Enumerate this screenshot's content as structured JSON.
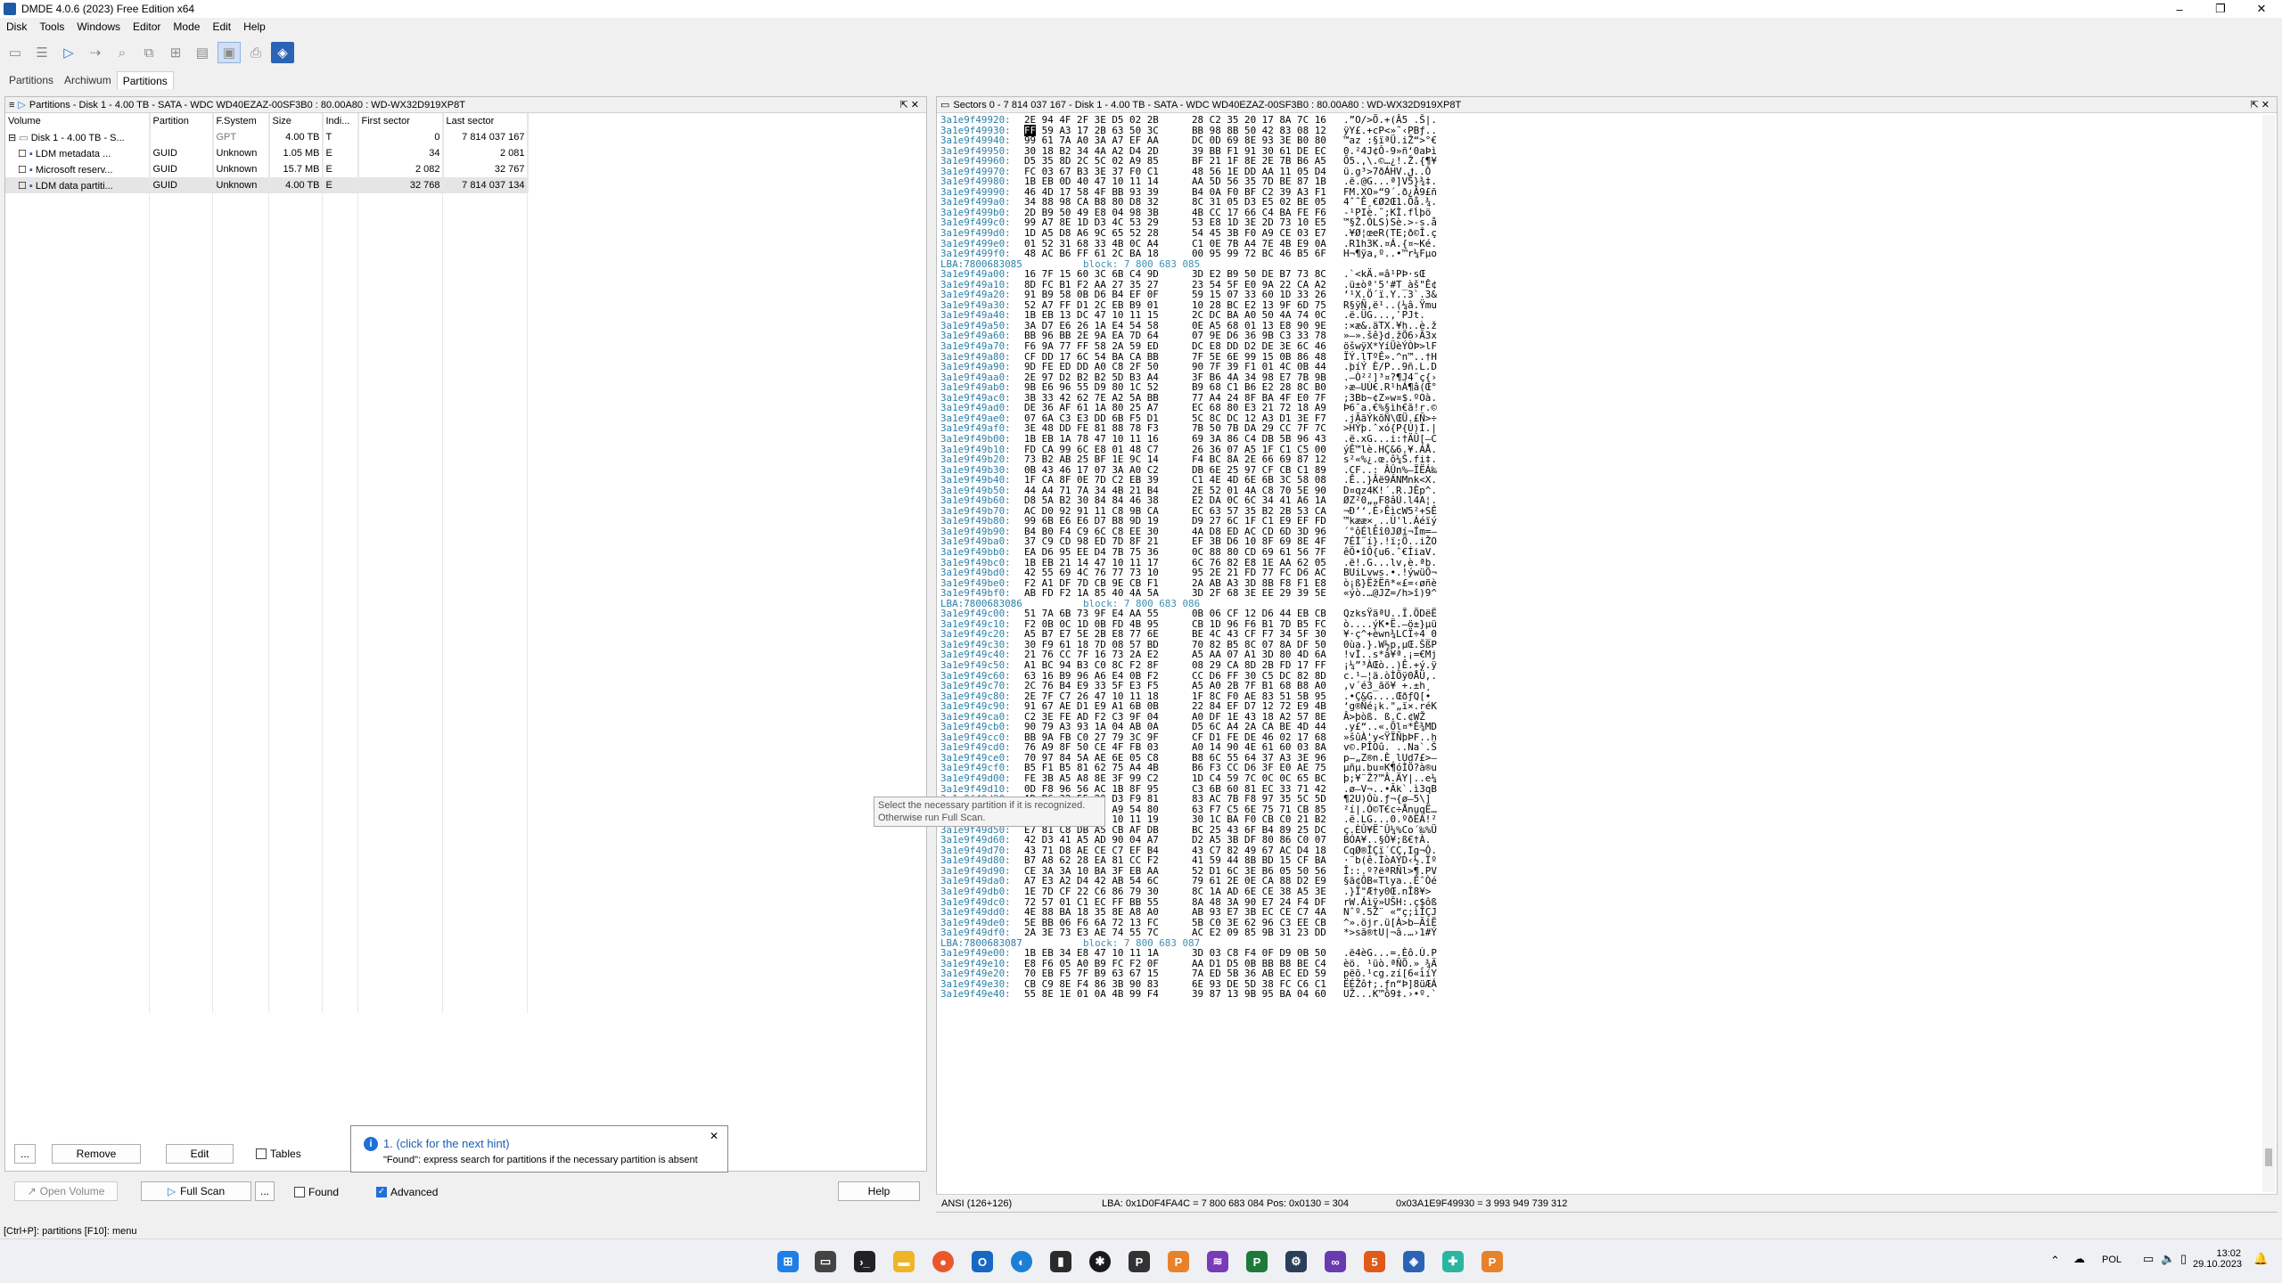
{
  "window": {
    "title": "DMDE 4.0.6 (2023) Free Edition x64",
    "minimize": "–",
    "maximize": "❐",
    "close": "✕"
  },
  "menu": [
    "Disk",
    "Tools",
    "Windows",
    "Editor",
    "Mode",
    "Edit",
    "Help"
  ],
  "tabs": [
    "Partitions",
    "Archiwum",
    "Partitions"
  ],
  "left_panel": {
    "header": "Partitions - Disk 1 - 4.00 TB - SATA - WDC WD40EZAZ-00SF3B0 : 80.00A80 : WD-WX32D919XP8T",
    "columns": [
      "Volume",
      "Partition",
      "F.System",
      "Size",
      "Indi...",
      "First sector",
      "Last sector"
    ],
    "rows": [
      {
        "volume": "Disk 1 - 4.00 TB - S...",
        "partition": "",
        "fs": "GPT",
        "size": "4.00 TB",
        "ind": "T",
        "first": "0",
        "last": "7 814 037 167"
      },
      {
        "volume": "LDM metadata ...",
        "partition": "GUID",
        "fs": "Unknown",
        "size": "1.05 MB",
        "ind": "E",
        "first": "34",
        "last": "2 081"
      },
      {
        "volume": "Microsoft reserv...",
        "partition": "GUID",
        "fs": "Unknown",
        "size": "15.7 MB",
        "ind": "E",
        "first": "2 082",
        "last": "32 767"
      },
      {
        "volume": "LDM data partiti...",
        "partition": "GUID",
        "fs": "Unknown",
        "size": "4.00 TB",
        "ind": "E",
        "first": "32 768",
        "last": "7 814 037 134"
      }
    ]
  },
  "right_panel": {
    "header": "Sectors 0 - 7 814 037 167 - Disk 1 - 4.00 TB - SATA - WDC WD40EZAZ-00SF3B0 : 80.00A80 : WD-WX32D919XP8T",
    "hex_lines": [
      [
        "3a1e9f49920:",
        "2E 94 4F 2F 3E D5 02 2B",
        "28 C2 35 20 17 8A 7C 16",
        ".”O/>Õ.+(Â5 .Š|."
      ],
      [
        "3a1e9f49930:",
        "FF 59 A3 17 2B 63 50 3C",
        "BB 98 8B 50 42 83 08 12",
        "ÿY£.+cP<»˜‹PBƒ.."
      ],
      [
        "3a1e9f49940:",
        "99 61 7A A0 3A A7 EF AA",
        "DC 0D 69 8E 93 3E B0 80",
        "™az :§ïªÜ.iŽ“>°€"
      ],
      [
        "3a1e9f49950:",
        "30 18 B2 34 4A A2 D4 2D",
        "39 BB F1 91 30 61 DE EC",
        "0.²4J¢Ô-9»ñ‘0aÞì"
      ],
      [
        "3a1e9f49960:",
        "D5 35 8D 2C 5C 02 A9 85",
        "BF 21 1F 8E 2E 7B B6 A5",
        "Õ5.,\\.©…¿!.Ž.{¶¥"
      ],
      [
        "3a1e9f49970:",
        "FC 03 67 B3 3E 37 F0 C1",
        "48 56 1E DD AA 11 05 D4",
        "ü.g³>7ðÁHV.ݪ..Ô"
      ],
      [
        "3a1e9f49980:",
        "1B EB 0D 40 47 10 11 14",
        "AA 5D 56 35 7D BE 87 1B",
        ".ë.@G...ª]V5}¾‡."
      ],
      [
        "3a1e9f49990:",
        "46 4D 17 58 4F BB 93 39",
        "B4 0A F0 BF C2 39 A3 F1",
        "FM.XO»“9´.ð¿Â9£ñ"
      ],
      [
        "3a1e9f499a0:",
        "34 88 98 CA B8 80 D8 32",
        "8C 31 05 D3 E5 02 BE 05",
        "4ˆ˜Ê¸€Ø2Œ1.Óå.¾."
      ],
      [
        "3a1e9f499b0:",
        "2D B9 50 49 E8 04 98 3B",
        "4B CC 17 66 C4 BA FE F6",
        "-¹PIè.˜;KÌ.fĺþö"
      ],
      [
        "3a1e9f499c0:",
        "99 A7 8E 1D D3 4C 53 29",
        "53 E8 1D 3E 2D 73 10 E5",
        "™§Ž.ÓLS)Sè.>-s.å"
      ],
      [
        "3a1e9f499d0:",
        "1D A5 D8 A6 9C 65 52 28",
        "54 45 3B F0 A9 CE 03 E7",
        ".¥Ø¦œeR(TE;ð©Î.ç"
      ],
      [
        "3a1e9f499e0:",
        "01 52 31 68 33 4B 0C A4",
        "C1 0E 7B A4 7E 4B E9 0A",
        ".R1h3K.¤Á.{¤~Ké."
      ],
      [
        "3a1e9f499f0:",
        "48 AC B6 FF 61 2C BA 18",
        "00 95 99 72 BC 46 B5 6F",
        "H¬¶ÿa,º..•™r¼Fµo"
      ],
      [
        "LBA:7800683085",
        "block: 7 800 683 085",
        "",
        ""
      ],
      [
        "3a1e9f49a00:",
        "16 7F 15 60 3C 6B C4 9D",
        "3D E2 B9 50 DE B7 73 8C",
        ".`<kÄ.=â¹PÞ·sŒ"
      ],
      [
        "3a1e9f49a10:",
        "8D FC B1 F2 AA 27 35 27",
        "23 54 5F E0 9A 22 CA A2",
        ".ü±òª'5'#T_àš\"Ê¢"
      ],
      [
        "3a1e9f49a20:",
        "91 B9 58 0B D6 B4 EF 0F",
        "59 15 07 33 60 1D 33 26",
        "‘¹X.Ö´ï.Y..3`.3&"
      ],
      [
        "3a1e9f49a30:",
        "52 A7 FF D1 2C EB B9 01",
        "10 28 BC E2 13 9F 6D 75",
        "R§ÿÑ,ë¹..(¼â.Ÿmu"
      ],
      [
        "3a1e9f49a40:",
        "1B EB 13 DC 47 10 11 15",
        "2C DC BA A0 50 4A 74 0C",
        ".ë.ÜG...,ܺ PJt."
      ],
      [
        "3a1e9f49a50:",
        "3A D7 E6 26 1A E4 54 58",
        "0E A5 68 01 13 E8 90 9E",
        ":×æ&.äTX.¥h..è.ž"
      ],
      [
        "3a1e9f49a60:",
        "BB 96 BB 2E 9A EA 7D 64",
        "07 9E D6 36 9B C3 33 78",
        "»–».šê}d.žÖ6›Ã3x"
      ],
      [
        "3a1e9f49a70:",
        "F6 9A 77 FF 58 2A 59 ED",
        "DC E8 DD D2 DE 3E 6C 46",
        "öšwÿX*YíÜèÝÒÞ>lF"
      ],
      [
        "3a1e9f49a80:",
        "CF DD 17 6C 54 BA CA BB",
        "7F 5E 6E 99 15 0B 86 48",
        "ÏÝ.lTºÊ».^n™..†H"
      ],
      [
        "3a1e9f49a90:",
        "9D FE ED DD A0 C8 2F 50",
        "90 7F 39 F1 01 4C 0B 44",
        ".þíÝ È/P..9ñ.L.D"
      ],
      [
        "3a1e9f49aa0:",
        "2E 97 D2 B2 B2 5D B3 A4",
        "3F B6 4A 34 98 E7 7B 9B",
        ".—Ò²²]³¤?¶J4˜ç{›"
      ],
      [
        "3a1e9f49ab0:",
        "9B E6 96 55 D9 80 1C 52",
        "B9 68 C1 B6 E2 28 8C B0",
        "›æ–UÙ€.R¹hÁ¶â(Œ°"
      ],
      [
        "3a1e9f49ac0:",
        "3B 33 42 62 7E A2 5A BB",
        "77 A4 24 8F BA 4F E0 7F",
        ";3Bb~¢Z»w¤$.ºOà."
      ],
      [
        "3a1e9f49ad0:",
        "DE 36 AF 61 1A 80 25 A7",
        "EC 68 80 E3 21 72 18 A9",
        "Þ6¯a.€%§ìh€ã!r.©"
      ],
      [
        "3a1e9f49ae0:",
        "07 6A C3 E3 DD 6B F5 D1",
        "5C 8C DC 12 A3 D1 3E F7",
        ".jÃãÝkõÑ\\ŒÜ.£Ñ>÷"
      ],
      [
        "3a1e9f49af0:",
        "3E 48 DD FE 81 88 78 F3",
        "7B 50 7B DA 29 CC 7F 7C",
        ">HÝþ.ˆxó{P{Ú)Ì.|"
      ],
      [
        "3a1e9f49b00:",
        "1B EB 1A 78 47 10 11 16",
        "69 3A 86 C4 DB 5B 96 43",
        ".ë.xG...i:†ÄÛ[–C"
      ],
      [
        "3a1e9f49b10:",
        "FD CA 99 6C E8 01 48 C7",
        "26 36 07 A5 1F C1 C5 00",
        "ýÊ™lè.HÇ&6.¥.ÁÅ."
      ],
      [
        "3a1e9f49b20:",
        "73 B2 AB 25 BF 1E 9C 14",
        "F4 BC 8A 2E 66 69 87 12",
        "s²«%¿.œ.ô¼Š.fi‡."
      ],
      [
        "3a1e9f49b30:",
        "0B 43 46 17 07 3A A0 C2",
        "DB 6E 25 97 CF CB C1 89",
        ".CF..: ÂÛn%—ÏËÁ‰"
      ],
      [
        "3a1e9f49b40:",
        "1F CA 8F 0E 7D C2 EB 39",
        "C1 4E 4D 6E 6B 3C 58 08",
        ".Ê..}Âë9ÁNMnk<X."
      ],
      [
        "3a1e9f49b50:",
        "44 A4 71 7A 34 4B 21 B4",
        "2E 52 01 4A C8 70 5E 90",
        "D¤qz4K!´.R.JÈp^."
      ],
      [
        "3a1e9f49b60:",
        "D8 5A B2 30 84 84 46 38",
        "E2 DA 0C 6C 34 41 A6 1A",
        "ØZ²0„„F8âÚ.l4A¦."
      ],
      [
        "3a1e9f49b70:",
        "AC D0 92 91 11 C8 9B CA",
        "EC 63 57 35 B2 2B 53 CA",
        "¬Ð’‘.È›ÊìcW5²+SÊ"
      ],
      [
        "3a1e9f49b80:",
        "99 6B E6 E6 D7 B8 9D 19",
        "D9 27 6C 1F C1 E9 EF FD",
        "™kææ×¸..Ù'l.Áéïý"
      ],
      [
        "3a1e9f49b90:",
        "B4 B0 F4 C9 6C C8 EE 30",
        "4A D8 ED AC CD 6D 3D 96",
        "´°ôÉlÈî0JØí¬Ím=–"
      ],
      [
        "3a1e9f49ba0:",
        "37 C9 CD 98 ED 7D 8F 21",
        "EF 3B D6 10 8F 69 8E 4F",
        "7ÉÍ˜í}.!ï;Ö..iŽO"
      ],
      [
        "3a1e9f49bb0:",
        "EA D6 95 EE D4 7B 75 36",
        "0C 88 80 CD 69 61 56 7F",
        "êÖ•îÔ{u6.ˆ€ÍiaV."
      ],
      [
        "3a1e9f49bc0:",
        "1B EB 21 14 47 10 11 17",
        "6C 76 82 E8 1E AA 62 05",
        ".ë!.G...lv‚è.ªb."
      ],
      [
        "3a1e9f49bd0:",
        "42 55 69 4C 76 77 73 10",
        "95 2E 21 FD 77 FC D6 AC",
        "BUiLvws.•.!ýwüÖ¬"
      ],
      [
        "3a1e9f49be0:",
        "F2 A1 DF 7D CB 9E CB F1",
        "2A AB A3 3D 8B F8 F1 E8",
        "ò¡ß}ËžËñ*«£=‹øñè"
      ],
      [
        "3a1e9f49bf0:",
        "AB FD F2 1A 85 40 4A 5A",
        "3D 2F 68 3E EE 29 39 5E",
        "«ýò.…@JZ=/h>î)9^"
      ],
      [
        "LBA:7800683086",
        "block: 7 800 683 086",
        "",
        ""
      ],
      [
        "3a1e9f49c00:",
        "51 7A 6B 73 9F E4 AA 55",
        "0B 06 CF 12 D6 44 EB CB",
        "QzksŸäªU..Ï.ÖDëË"
      ],
      [
        "3a1e9f49c10:",
        "F2 0B 0C 1D 0B FD 4B 95",
        "CB 1D 96 F6 B1 7D B5 FC",
        "ò....ýK•Ë.–ö±}µü"
      ],
      [
        "3a1e9f49c20:",
        "A5 B7 E7 5E 2B E8 77 6E",
        "BE 4C 43 CF F7 34 5F 30",
        "¥·ç^+èwn¾LCÏ÷4_0"
      ],
      [
        "3a1e9f49c30:",
        "30 F9 61 18 7D 08 57 BD",
        "70 82 B5 8C 07 8A DF 50",
        "0ùa.}.W½p‚µŒ.ŠßP"
      ],
      [
        "3a1e9f49c40:",
        "21 76 CC 7F 16 73 2A E2",
        "A5 AA 07 A1 3D 80 4D 6A",
        "!vÌ..s*â¥ª.¡=€Mj"
      ],
      [
        "3a1e9f49c50:",
        "A1 BC 94 B3 C0 8C F2 8F",
        "08 29 CA 8D 2B FD 17 FF",
        "¡¼”³ÀŒò..)Ê.+ý.ÿ"
      ],
      [
        "3a1e9f49c60:",
        "63 16 B9 96 A6 E4 0B F2",
        "CC D6 FF 30 C5 DC 82 8D",
        "c.¹–¦ä.òÌÖÿ0ÅÜ‚."
      ],
      [
        "3a1e9f49c70:",
        "2C 76 B4 E9 33 5F E3 F5",
        "A5 A0 2B 7F B1 68 B8 A0",
        ",v´é3_ãõ¥ +.±h¸ "
      ],
      [
        "3a1e9f49c80:",
        "2E 7F C7 26 47 10 11 18",
        "1F 8C F0 AE 83 51 5B 95",
        ".•Ç&G....ŒðƒQ[•"
      ],
      [
        "3a1e9f49c90:",
        "91 67 AE D1 E9 A1 6B 0B",
        "22 84 EF D7 12 72 E9 4B",
        "‘g®Ñé¡k.\"„ï×.réK"
      ],
      [
        "3a1e9f49ca0:",
        "C2 3E FE AD F2 C3 9F 04",
        "A0 DF 1E 43 18 A2 57 8E",
        "Â>þ­òß. ß.C.¢WŽ"
      ],
      [
        "3a1e9f49cb0:",
        "90 79 A3 93 1A 04 AB 0A",
        "D5 6C A4 2A CA BE 4D 44",
        ".y£“..«.Õl¤*Ê¾MD"
      ],
      [
        "3a1e9f49cc0:",
        "BB 9A FB C0 27 79 3C 9F",
        "CF D1 FE DE 46 02 17 68",
        "»šûÀ'y<ŸÏÑþÞF..h"
      ],
      [
        "3a1e9f49cd0:",
        "76 A9 8F 50 CE 4F FB 03",
        "A0 14 90 4E 61 60 03 8A",
        "v©.PÎOû. ..Na`.Š"
      ],
      [
        "3a1e9f49ce0:",
        "70 97 84 5A AE 6E 05 C8",
        "B8 6C 55 64 37 A3 3E 96",
        "p—„Z®n.È¸lUd7£>–"
      ],
      [
        "3a1e9f49cf0:",
        "B5 F1 B5 81 62 75 A4 4B",
        "B6 F3 CC D6 3F E0 AE 75",
        "µñµ.bu¤K¶óÌÖ?à®u"
      ],
      [
        "3a1e9f49d00:",
        "FE 3B A5 A8 8E 3F 99 C2",
        "1D C4 59 7C 0C 0C 65 BC",
        "þ;¥¨Ž?™Â.ÄY|..e¼"
      ],
      [
        "3a1e9f49d10:",
        "0D F8 96 56 AC 1B 8F 95",
        "C3 6B 60 81 EC 33 71 42",
        ".ø–V¬..•Ãk`.ì3qB"
      ],
      [
        "3a1e9f49d20:",
        "AD B6 32 55 29 D3 F9 81",
        "83 AC 7B F8 97 35 5C 5D",
        "­¶2U)Óù.ƒ¬{ø—5\\]"
      ],
      [
        "3a1e9f49d30:",
        "B2 ED 7C 1F D3 A9 54 80",
        "63 F7 C5 6E 75 71 CB 85",
        "²í|.Ó©T€c÷ÅnuqË…"
      ],
      [
        "3a1e9f49d40:",
        "1B EB 2E 4C 47 10 11 19",
        "30 1C BA F0 CB C0 21 B2",
        ".ë.LG...0.ºðËÀ!²"
      ],
      [
        "3a1e9f49d50:",
        "E7 81 C8 DB A5 CB AF DB",
        "BC 25 43 6F B4 89 25 DC",
        "ç.ÈÛ¥Ë¯Û¼%Co´‰%Ü"
      ],
      [
        "3a1e9f49d60:",
        "42 D3 41 A5 AD 90 04 A7",
        "D2 A5 3B DF 80 86 C0 07",
        "BÓA¥­..§Ò¥;ß€†À."
      ],
      [
        "3a1e9f49d70:",
        "43 71 D8 AE CE C7 EF B4",
        "43 C7 82 49 67 AC D4 18",
        "CqØ®ÎÇï´CÇ‚Ig¬Ô."
      ],
      [
        "3a1e9f49d80:",
        "B7 A8 62 28 EA 81 CC F2",
        "41 59 44 8B BD 15 CF BA",
        "·¨b(ê.ÌòAYD‹½.Ïº"
      ],
      [
        "3a1e9f49d90:",
        "CE 3A 3A 10 BA 3F EB AA",
        "52 D1 6C 3E B6 05 50 56",
        "Î::.º?ëªRÑl>¶.PV"
      ],
      [
        "3a1e9f49da0:",
        "A7 E3 A2 D4 42 AB 54 6C",
        "79 61 2E 0E CA 88 D2 E9",
        "§ã¢ÔB«Tlya..ÊˆÒé"
      ],
      [
        "3a1e9f49db0:",
        "1E 7D CF 22 C6 86 79 30",
        "8C 1A AD 6E CE 38 A5 3E",
        ".}Ï\"Æ†y0Œ.­nÎ8¥>"
      ],
      [
        "3a1e9f49dc0:",
        "72 57 01 C1 EC FF BB 55",
        "8A 48 3A 90 E7 24 F4 DF",
        "rW.Áìÿ»UŠH:.ç$ôß"
      ],
      [
        "3a1e9f49dd0:",
        "4E 88 BA 18 35 8E A8 A0",
        "AB 93 E7 3B EC CE C7 4A",
        "Nˆº.5Ž¨ «“ç;ìÎÇJ"
      ],
      [
        "3a1e9f49de0:",
        "5E BB 06 F6 6A 72 13 FC",
        "5B C0 3E 62 96 C3 EE CB",
        "^».öjr.ü[À>b–ÃîË"
      ],
      [
        "3a1e9f49df0:",
        "2A 3E 73 E3 AE 74 55 7C",
        "AC E2 09 85 9B 31 23 DD",
        "*>sã®tU|¬â.…›1#Ý"
      ],
      [
        "LBA:7800683087",
        "block: 7 800 683 087",
        "",
        ""
      ],
      [
        "3a1e9f49e00:",
        "1B EB 34 E8 47 10 11 1A",
        "3D 03 C8 F4 0F D9 0B 50",
        ".ë4èG...=.Èô.Ù.P"
      ],
      [
        "3a1e9f49e10:",
        "E8 F6 05 A0 B9 FC F2 0F",
        "AA D1 D5 0B BB B8 BE C4",
        "èö. ¹üò.ªÑÕ.»¸¾Ä"
      ],
      [
        "3a1e9f49e20:",
        "70 EB F5 7F B9 63 67 15",
        "7A ED 5B 36 AB EC ED 59",
        "pëõ.¹cg.zí[6«ìíY"
      ],
      [
        "3a1e9f49e30:",
        "CB C9 8E F4 86 3B 90 83",
        "6E 93 DE 5D 38 FC C6 C1",
        "ËÉŽô†;.ƒn“Þ]8üÆÁ"
      ],
      [
        "3a1e9f49e40:",
        "55 8E 1E 01 0A 4B 99 F4",
        "39 87 13 9B 95 BA 04 60",
        "UŽ...K™ô9‡.›•º.`"
      ]
    ],
    "status": {
      "mode": "ANSI (126+126)",
      "lba": "LBA: 0x1D0F4FA4C = 7 800 683 084  Pos: 0x0130 = 304",
      "offset": "0x03A1E9F49930 = 3 993 949 739 312"
    }
  },
  "bottom": {
    "dots1": "...",
    "remove": "Remove",
    "edit": "Edit",
    "tables": "Tables",
    "open_volume": "Open Volume",
    "full_scan": "Full Scan",
    "dots2": "...",
    "found": "Found",
    "advanced": "Advanced",
    "help": "Help"
  },
  "hint": {
    "title": "1. (click for the next hint)",
    "text": "\"Found\": express search for partitions if the necessary partition is absent"
  },
  "tooltip": {
    "line1": "Select the necessary partition if it is recognized.",
    "line2": "Otherwise run Full Scan."
  },
  "statusbar": "[Ctrl+P]: partitions  [F10]: menu",
  "tray": {
    "lang": "POL",
    "time": "13:02",
    "date": "29.10.2023"
  },
  "colors": {
    "accent": "#2b63b5",
    "hex_address": "#2a7fa6"
  }
}
